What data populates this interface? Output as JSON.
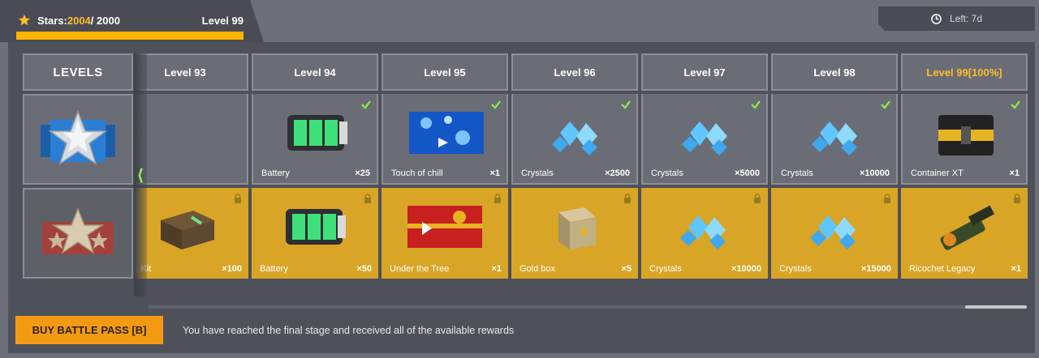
{
  "header": {
    "stars_label": "Stars: ",
    "stars_current": "2004",
    "stars_total": " / 2000",
    "level_label": "Level 99",
    "progress_fraction": 1.0,
    "time_left": "Left: 7d"
  },
  "levels_column": {
    "title": "LEVELS"
  },
  "nav": {
    "prev_glyph": "⟨"
  },
  "columns": [
    {
      "level": "Level 93",
      "free": {
        "name": "",
        "qty": "",
        "claimed": false,
        "empty": true
      },
      "premium": {
        "name": "pair Kit",
        "qty": "×100",
        "locked": true,
        "icon": "repair-kit-icon"
      }
    },
    {
      "level": "Level 94",
      "free": {
        "name": "Battery",
        "qty": "×25",
        "claimed": true,
        "icon": "battery-icon"
      },
      "premium": {
        "name": "Battery",
        "qty": "×50",
        "locked": true,
        "icon": "battery-icon"
      }
    },
    {
      "level": "Level 95",
      "free": {
        "name": "Touch of chill",
        "qty": "×1",
        "claimed": true,
        "icon": "paint-chill-icon"
      },
      "premium": {
        "name": "Under the Tree",
        "qty": "×1",
        "locked": true,
        "icon": "paint-tree-icon"
      }
    },
    {
      "level": "Level 96",
      "free": {
        "name": "Crystals",
        "qty": "×2500",
        "claimed": true,
        "icon": "crystals-icon"
      },
      "premium": {
        "name": "Gold box",
        "qty": "×5",
        "locked": true,
        "icon": "gold-box-icon"
      }
    },
    {
      "level": "Level 97",
      "free": {
        "name": "Crystals",
        "qty": "×5000",
        "claimed": true,
        "icon": "crystals-icon"
      },
      "premium": {
        "name": "Crystals",
        "qty": "×10000",
        "locked": true,
        "icon": "crystals-icon"
      }
    },
    {
      "level": "Level 98",
      "free": {
        "name": "Crystals",
        "qty": "×10000",
        "claimed": true,
        "icon": "crystals-icon"
      },
      "premium": {
        "name": "Crystals",
        "qty": "×15000",
        "locked": true,
        "icon": "crystals-icon"
      }
    },
    {
      "level": "Level 99[100%]",
      "current": true,
      "free": {
        "name": "Container XT",
        "qty": "×1",
        "claimed": true,
        "icon": "container-icon"
      },
      "premium": {
        "name": "Ricochet Legacy",
        "qty": "×1",
        "locked": true,
        "icon": "turret-icon"
      }
    }
  ],
  "footer": {
    "buy_button": "BUY BATTLE PASS [B]",
    "message": "You have reached the final stage and received all of the available rewards"
  },
  "colors": {
    "accent_yellow": "#ffbc2b",
    "premium_row": "#d8a526",
    "buy_button": "#f39a12",
    "check_green": "#8cf04a"
  }
}
